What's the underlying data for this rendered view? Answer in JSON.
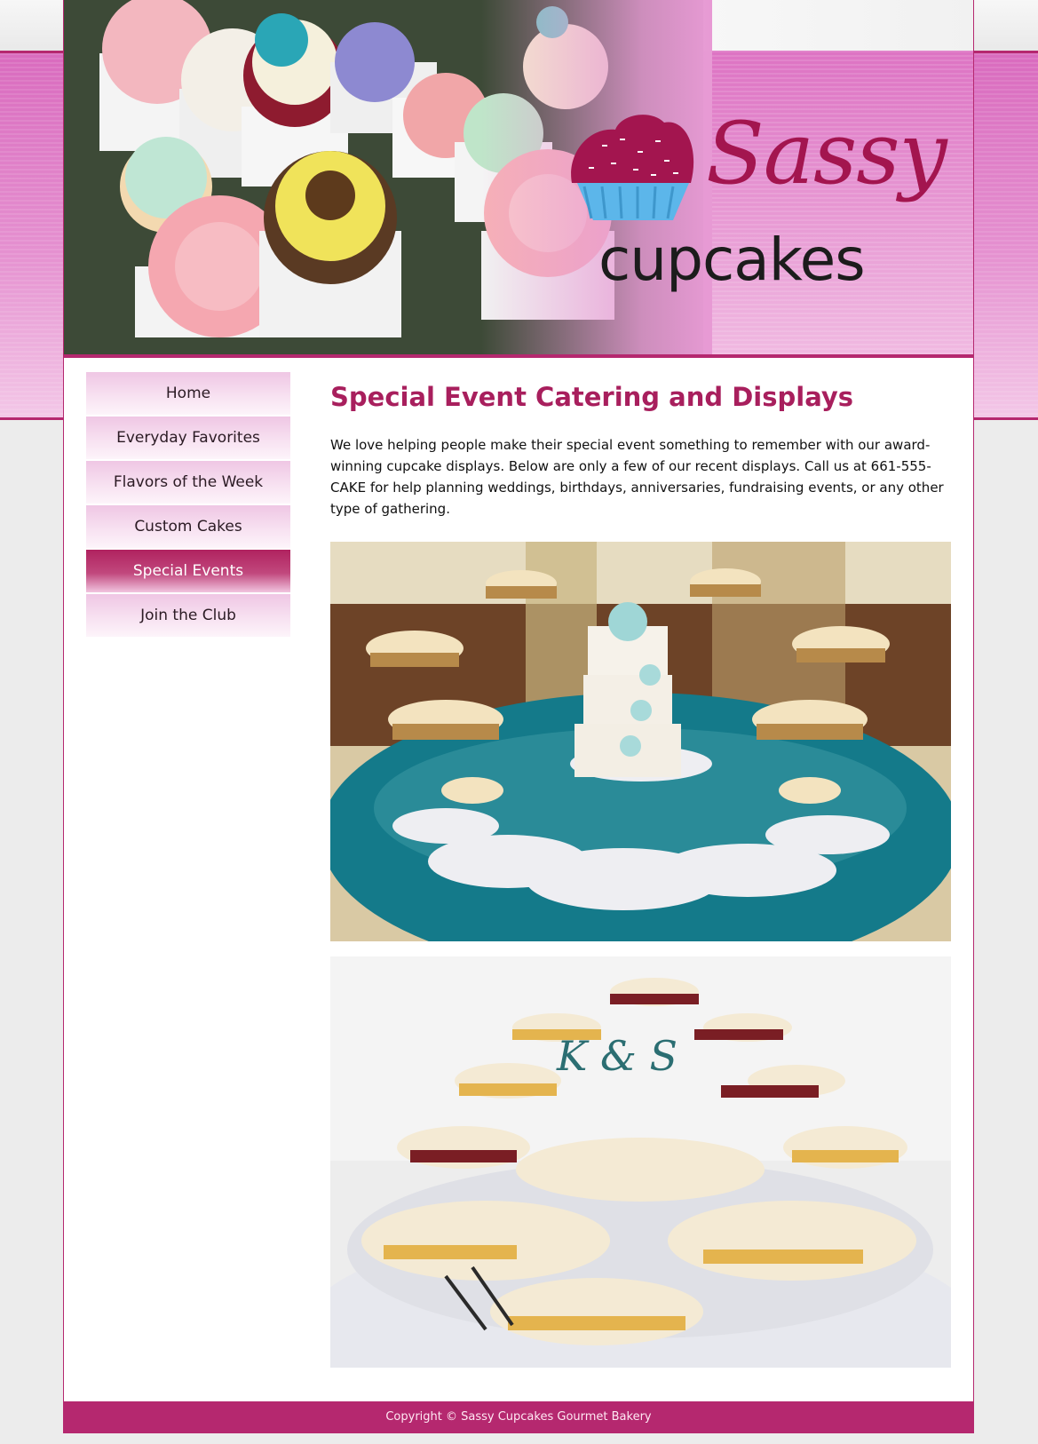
{
  "brand": {
    "name_line1": "Sassy",
    "name_line2": "cupcakes",
    "accent_color": "#b5286f"
  },
  "nav": {
    "items": [
      {
        "label": "Home",
        "active": false
      },
      {
        "label": "Everyday Favorites",
        "active": false
      },
      {
        "label": "Flavors of the Week",
        "active": false
      },
      {
        "label": "Custom Cakes",
        "active": false
      },
      {
        "label": "Special Events",
        "active": true
      },
      {
        "label": "Join the Club",
        "active": false
      }
    ]
  },
  "main": {
    "title": "Special Event Catering and Displays",
    "intro": "We love helping people make their special event something to remember with our award-winning cupcake displays. Below are only a few of our recent displays. Call us at 661-555-CAKE for help planning weddings, birthdays, anniversaries, fundraising events, or any other type of gathering.",
    "photos": [
      {
        "icon": "cupcake-display-teal-table"
      },
      {
        "icon": "cupcake-display-white-table",
        "monogram": "K & S"
      }
    ]
  },
  "footer": {
    "copyright": "Copyright © Sassy Cupcakes Gourmet Bakery"
  }
}
